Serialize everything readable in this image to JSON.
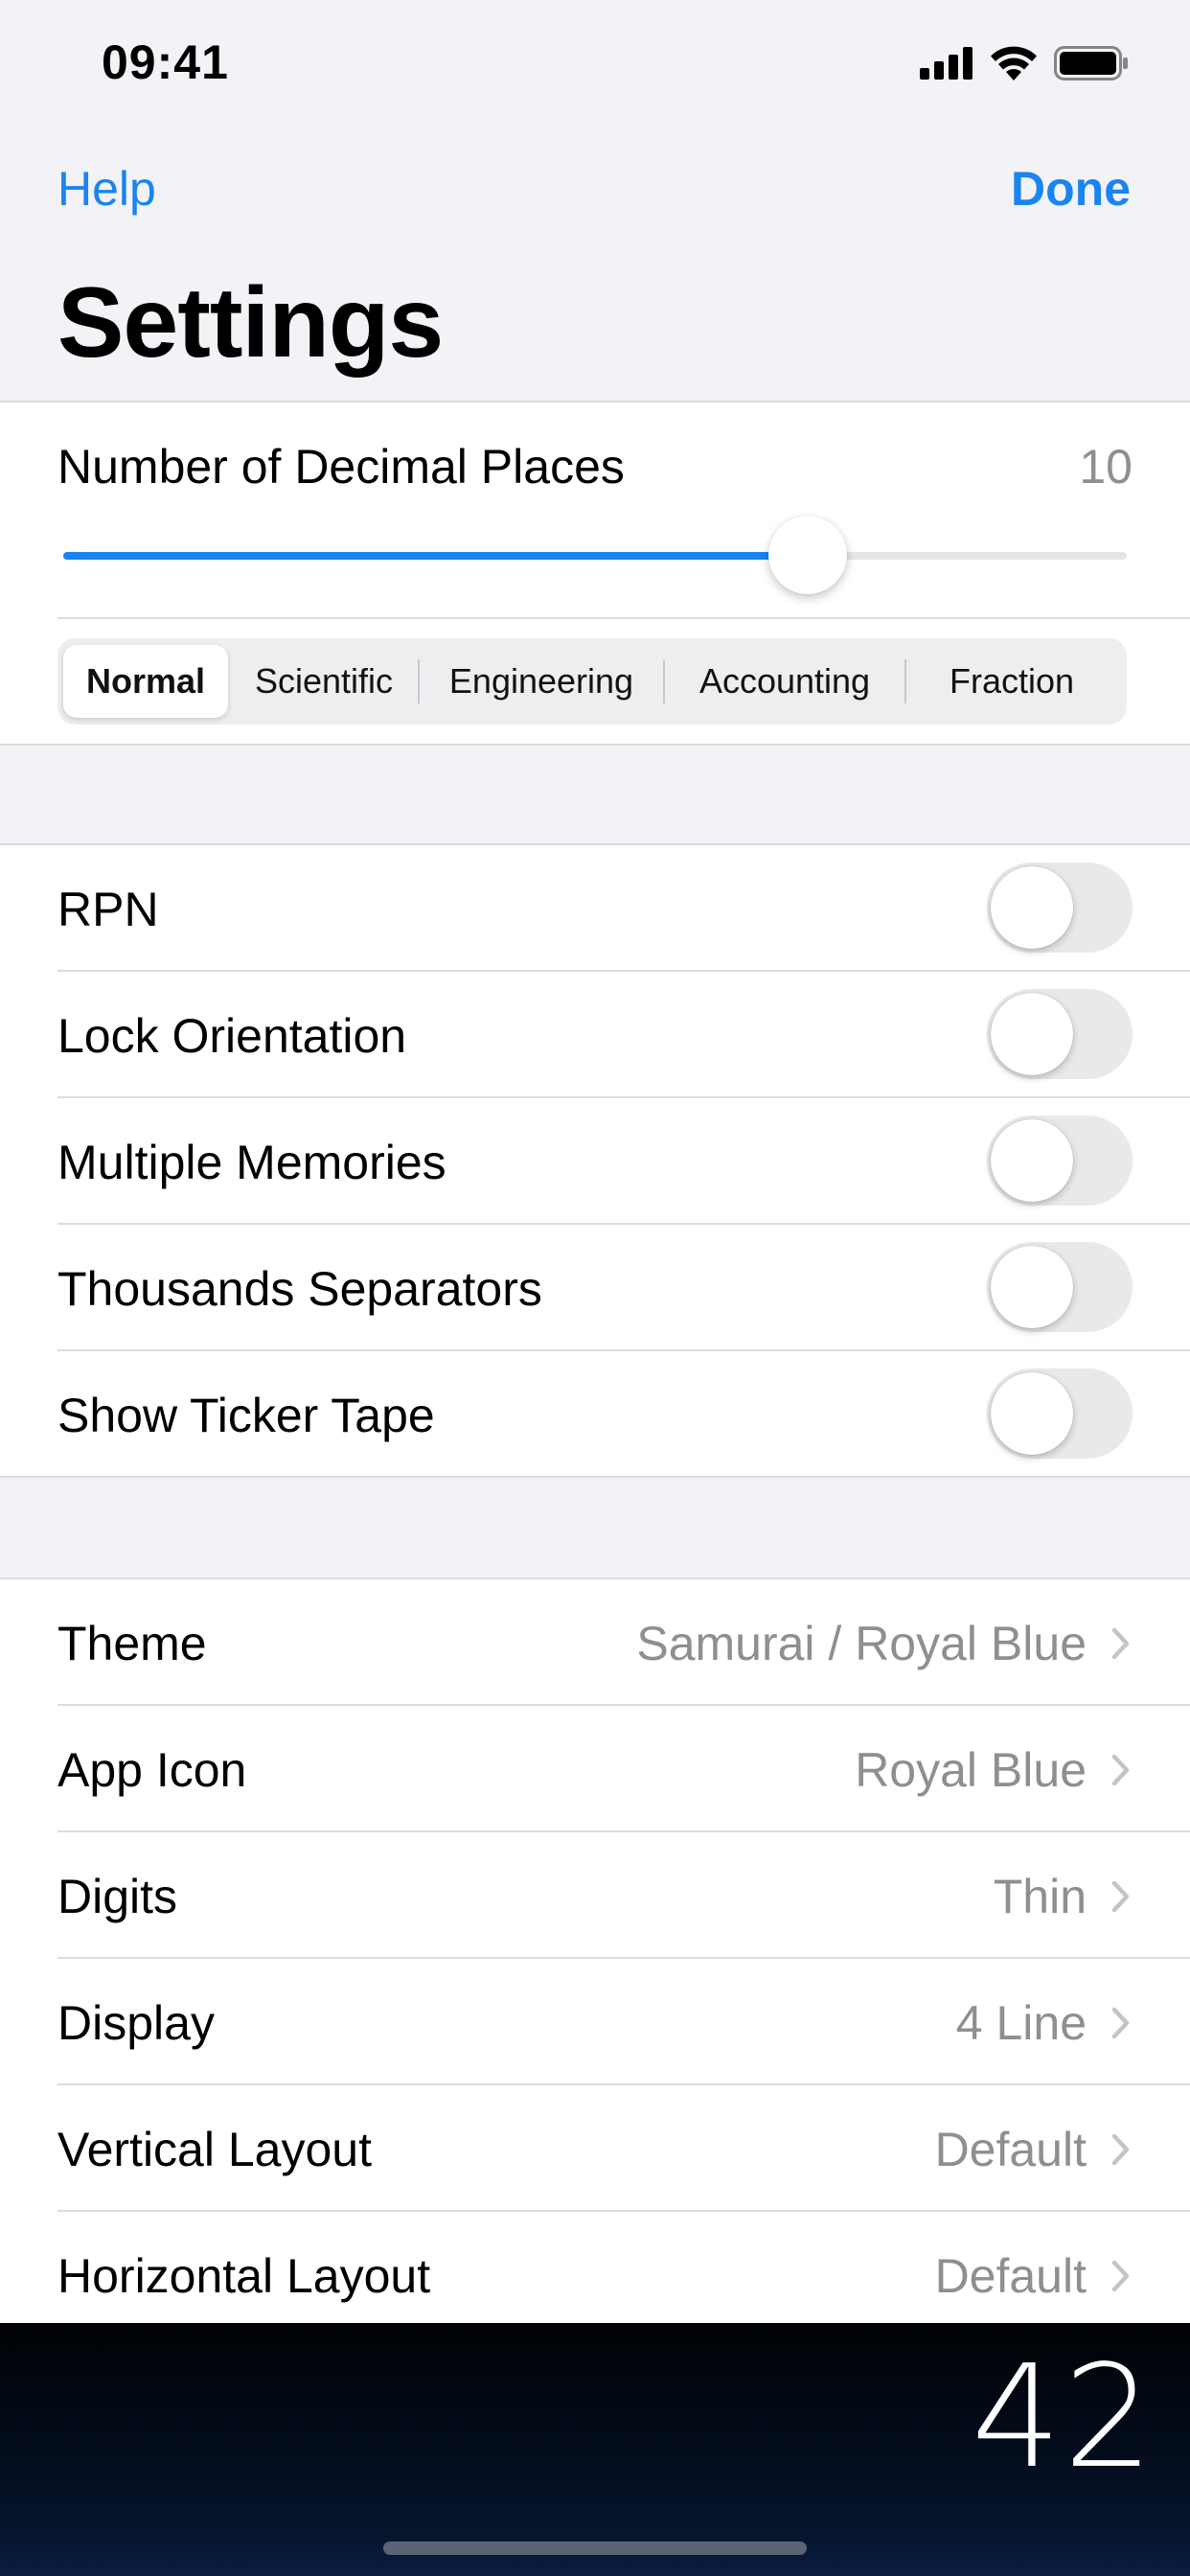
{
  "status_bar": {
    "time": "09:41"
  },
  "nav": {
    "left_button": "Help",
    "right_button": "Done",
    "title": "Settings"
  },
  "accent_color": "#1a84f0",
  "decimal_places": {
    "label": "Number of Decimal Places",
    "value": "10",
    "slider_fraction": 0.7
  },
  "number_format": {
    "options": [
      "Normal",
      "Scientific",
      "Engineering",
      "Accounting",
      "Fraction"
    ],
    "selected": "Normal"
  },
  "toggles": [
    {
      "label": "RPN",
      "on": false
    },
    {
      "label": "Lock Orientation",
      "on": false
    },
    {
      "label": "Multiple Memories",
      "on": false
    },
    {
      "label": "Thousands Separators",
      "on": false
    },
    {
      "label": "Show Ticker Tape",
      "on": false
    }
  ],
  "options": [
    {
      "label": "Theme",
      "value": "Samurai / Royal Blue"
    },
    {
      "label": "App Icon",
      "value": "Royal Blue"
    },
    {
      "label": "Digits",
      "value": "Thin"
    },
    {
      "label": "Display",
      "value": "4 Line"
    },
    {
      "label": "Vertical Layout",
      "value": "Default"
    },
    {
      "label": "Horizontal Layout",
      "value": "Default"
    }
  ],
  "calculator_display": {
    "value": "42"
  }
}
